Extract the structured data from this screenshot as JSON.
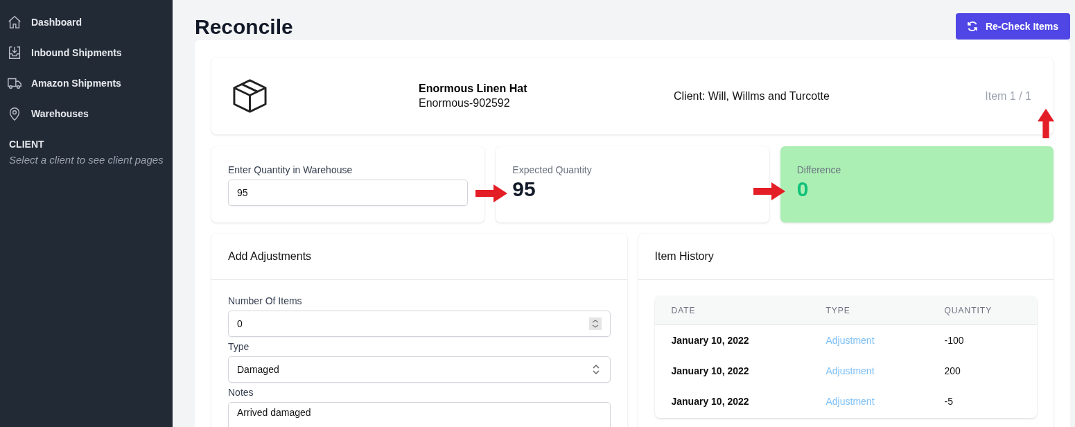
{
  "sidebar": {
    "items": [
      {
        "label": "Dashboard"
      },
      {
        "label": "Inbound Shipments"
      },
      {
        "label": "Amazon Shipments"
      },
      {
        "label": "Warehouses"
      }
    ],
    "section": {
      "heading": "CLIENT",
      "hint": "Select a client to see client pages"
    }
  },
  "page": {
    "title": "Reconcile",
    "action_button": "Re-Check Items"
  },
  "product": {
    "name": "Enormous Linen Hat",
    "sku": "Enormous-902592",
    "client": "Client: Will, Willms and Turcotte",
    "position": "Item 1 / 1"
  },
  "quantities": {
    "entered": {
      "label": "Enter Quantity in Warehouse",
      "value": "95"
    },
    "expected": {
      "label": "Expected Quantity",
      "value": "95"
    },
    "difference": {
      "label": "Difference",
      "value": "0"
    }
  },
  "adjustments": {
    "title": "Add Adjustments",
    "fields": [
      {
        "kind": "number",
        "label": "Number Of Items",
        "value": "0"
      },
      {
        "kind": "select",
        "label": "Type",
        "value": "Damaged"
      },
      {
        "kind": "text",
        "label": "Notes",
        "value": "Arrived damaged"
      }
    ]
  },
  "history": {
    "title": "Item History",
    "columns": [
      "DATE",
      "TYPE",
      "QUANTITY"
    ],
    "rows": [
      [
        "January 10, 2022",
        "Adjustment",
        "-100"
      ],
      [
        "January 10, 2022",
        "Adjustment",
        "200"
      ],
      [
        "January 10, 2022",
        "Adjustment",
        "-5"
      ]
    ]
  }
}
